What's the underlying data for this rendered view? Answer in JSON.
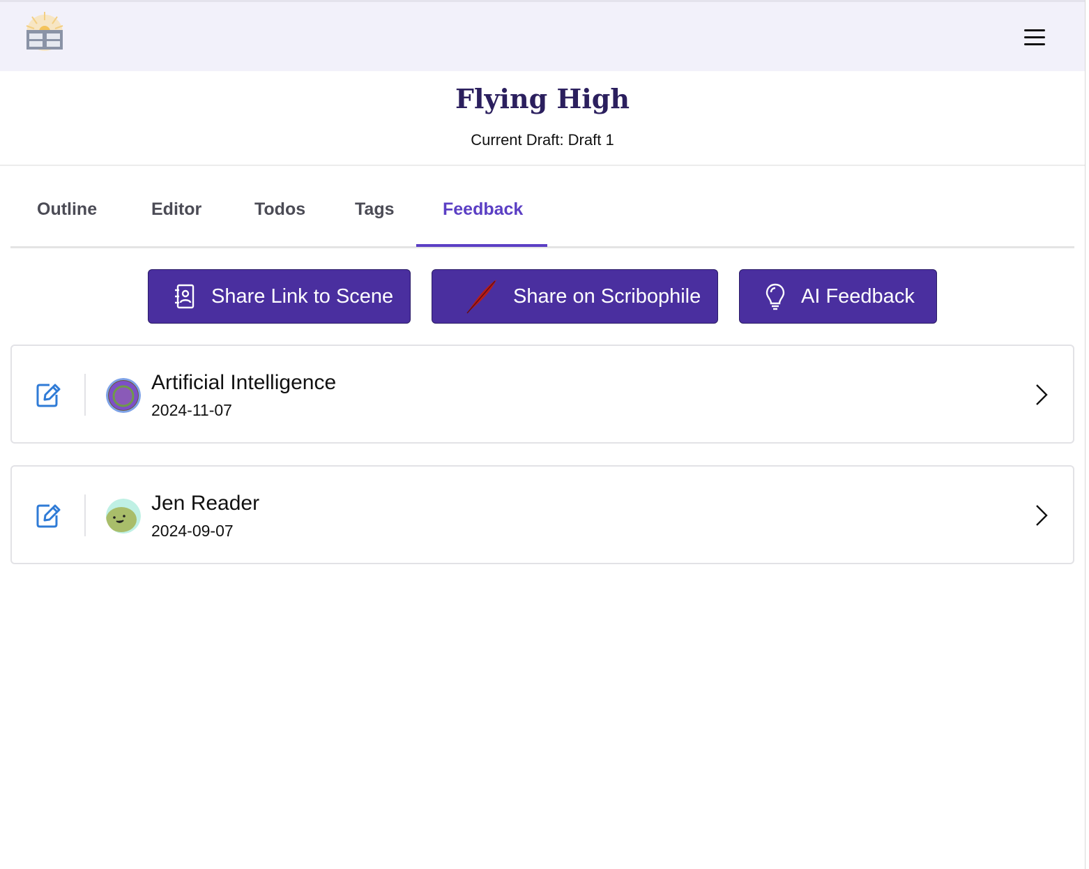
{
  "header": {
    "logo_icon": "sunrise-house-logo",
    "menu_icon": "hamburger-menu-icon"
  },
  "scene": {
    "title": "Flying High",
    "current_draft": "Current Draft: Draft 1"
  },
  "tabs": [
    {
      "label": "Outline",
      "active": false
    },
    {
      "label": "Editor",
      "active": false
    },
    {
      "label": "Todos",
      "active": false
    },
    {
      "label": "Tags",
      "active": false
    },
    {
      "label": "Feedback",
      "active": true
    }
  ],
  "actions": [
    {
      "label": "Share Link to Scene",
      "icon": "contact-book-icon"
    },
    {
      "label": "Share on Scribophile",
      "icon": "quill-icon"
    },
    {
      "label": "AI Feedback",
      "icon": "lightbulb-icon"
    }
  ],
  "feedback": [
    {
      "name": "Artificial Intelligence",
      "date": "2024-11-07",
      "avatar": "ai-avatar"
    },
    {
      "name": "Jen Reader",
      "date": "2024-09-07",
      "avatar": "smiley-avatar"
    }
  ],
  "colors": {
    "accent": "#5b3fc4",
    "button_bg": "#4a2f9f",
    "title": "#2b1f5e",
    "header_bg": "#f2f1fa",
    "edit_icon": "#2f7bd6"
  }
}
